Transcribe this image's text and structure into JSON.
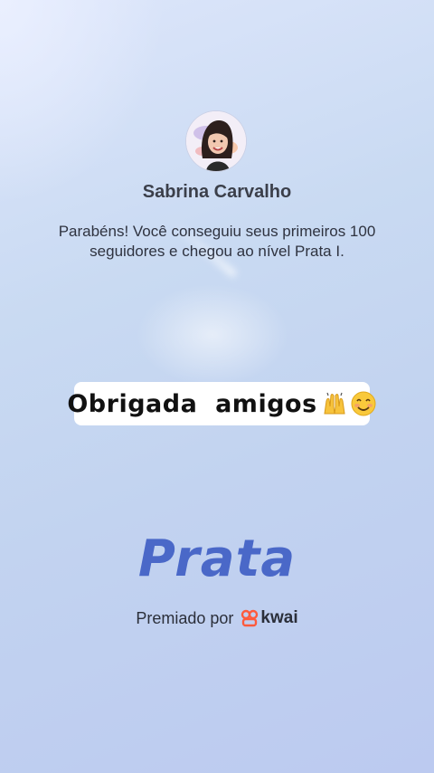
{
  "profile": {
    "name": "Sabrina Carvalho"
  },
  "message": "Parabéns! Você conseguiu seus primeiros 100 seguidores e chegou ao nível Prata I.",
  "caption": "Obrigada  amigos",
  "caption_emojis": [
    "raising-hands",
    "smiling-face"
  ],
  "level": {
    "label": "Prata",
    "color": "#4a68c8"
  },
  "award": {
    "prefix": "Premiado por",
    "brand": "kwai",
    "brand_color": "#ff5a3c"
  }
}
